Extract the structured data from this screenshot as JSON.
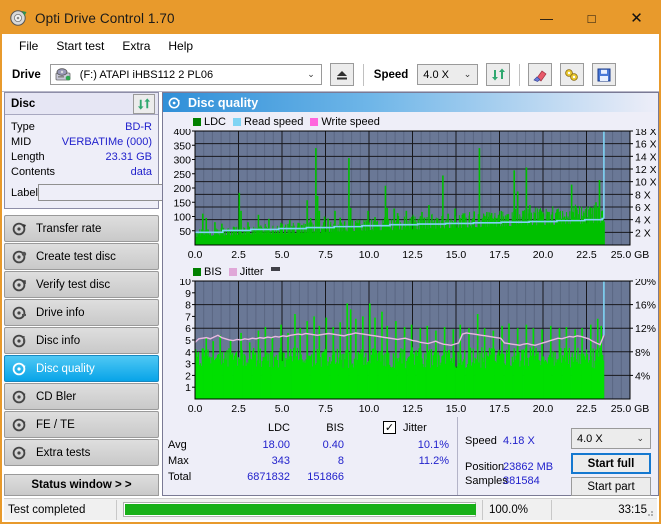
{
  "window": {
    "title": "Opti Drive Control 1.70",
    "icon": "disc-icon",
    "minimize": "—",
    "maximize": "□",
    "close": "✕",
    "titlebar_color": "#e89a2c"
  },
  "menu": {
    "items": [
      "File",
      "Start test",
      "Extra",
      "Help"
    ]
  },
  "toolbar": {
    "drive_label": "Drive",
    "drive_value": "(F:)  ATAPI iHBS112  2 PL06",
    "eject_icon": "eject-icon",
    "speed_label": "Speed",
    "speed_value": "4.0 X",
    "refresh_icon": "refresh-icon",
    "eraser_icon": "eraser-icon",
    "tools_icon": "tools-icon",
    "save_icon": "save-icon",
    "arrow": "⌄"
  },
  "disc_panel": {
    "title": "Disc",
    "refresh_icon": "refresh-icon",
    "rows": [
      {
        "key": "Type",
        "value": "BD-R"
      },
      {
        "key": "MID",
        "value": "VERBATIMe (000)"
      },
      {
        "key": "Length",
        "value": "23.31 GB"
      },
      {
        "key": "Contents",
        "value": "data"
      }
    ],
    "label_key": "Label",
    "label_value": "",
    "label_placeholder": "",
    "label_button_icon": "disc-icon"
  },
  "sidebar": {
    "items": [
      {
        "label": "Transfer rate",
        "icon": "disc-rate-icon",
        "selected": false
      },
      {
        "label": "Create test disc",
        "icon": "disc-create-icon",
        "selected": false
      },
      {
        "label": "Verify test disc",
        "icon": "disc-verify-icon",
        "selected": false
      },
      {
        "label": "Drive info",
        "icon": "drive-info-icon",
        "selected": false
      },
      {
        "label": "Disc info",
        "icon": "disc-info-icon",
        "selected": false
      },
      {
        "label": "Disc quality",
        "icon": "disc-quality-icon",
        "selected": true
      },
      {
        "label": "CD Bler",
        "icon": "cd-bler-icon",
        "selected": false
      },
      {
        "label": "FE / TE",
        "icon": "fe-te-icon",
        "selected": false
      },
      {
        "label": "Extra tests",
        "icon": "extra-tests-icon",
        "selected": false
      }
    ],
    "status_window_button": "Status window > >"
  },
  "panel": {
    "title": "Disc quality",
    "icon": "disc-quality-icon"
  },
  "results": {
    "col_ldc": "LDC",
    "col_bis": "BIS",
    "jitter_label": "Jitter",
    "jitter_checked": true,
    "check_glyph": "✓",
    "rows": [
      {
        "label": "Avg",
        "ldc": "18.00",
        "bis": "0.40",
        "jitter": "10.1%"
      },
      {
        "label": "Max",
        "ldc": "343",
        "bis": "8",
        "jitter": "11.2%"
      },
      {
        "label": "Total",
        "ldc": "6871832",
        "bis": "151866",
        "jitter": ""
      }
    ],
    "speed_label": "Speed",
    "speed_value": "4.18 X",
    "position_label": "Position",
    "position_value": "23862 MB",
    "samples_label": "Samples",
    "samples_value": "381584",
    "speed_select": "4.0 X",
    "speed_select_arrow": "⌄",
    "start_full": "Start full",
    "start_part": "Start part"
  },
  "statusbar": {
    "message": "Test completed",
    "progress_pct": "100.0%",
    "progress_value": 100,
    "elapsed": "33:15"
  },
  "colors": {
    "ldc_green": "#00c000",
    "read_speed_blue": "#7fd4f4",
    "write_speed_pink": "#ff66dd",
    "bis_green": "#00e000",
    "jitter_pink": "#e8b8e0",
    "plot_bg": "#6a7896",
    "accent": "#1478d0",
    "value_text": "#2222cc"
  },
  "chart_data": [
    {
      "type": "area",
      "name": "ldc-chart",
      "title": "",
      "xlabel": "GB",
      "ylabel": "",
      "legend": [
        {
          "label": "LDC",
          "color": "#008000"
        },
        {
          "label": "Read speed",
          "color": "#7fd4f4"
        },
        {
          "label": "Write speed",
          "color": "#ff66dd"
        }
      ],
      "legend_position": "top-left",
      "grid": true,
      "xlim": [
        0,
        25.0
      ],
      "ylim": [
        0,
        400
      ],
      "xticks": [
        0.0,
        2.5,
        5.0,
        7.5,
        10.0,
        12.5,
        15.0,
        17.5,
        20.0,
        22.5,
        25.0
      ],
      "xticklabels": [
        "0.0",
        "2.5",
        "5.0",
        "7.5",
        "10.0",
        "12.5",
        "15.0",
        "17.5",
        "20.0",
        "22.5",
        "25.0 GB"
      ],
      "yticks": [
        50,
        100,
        150,
        200,
        250,
        300,
        350,
        400
      ],
      "yticklabels": [
        "50",
        "100",
        "150",
        "200",
        "250",
        "300",
        "350",
        "400"
      ],
      "y2lim": [
        0,
        18
      ],
      "y2ticks": [
        2,
        4,
        6,
        8,
        10,
        12,
        14,
        16,
        18
      ],
      "y2ticklabels": [
        "2 X",
        "4 X",
        "6 X",
        "8 X",
        "10 X",
        "12 X",
        "14 X",
        "16 X",
        "18 X"
      ],
      "data_end_x": 23.5,
      "series": [
        {
          "name": "LDC",
          "color": "#00c000",
          "axis": "left",
          "baseline": [
            28,
            30,
            31,
            33,
            32,
            34,
            33,
            35,
            34,
            36,
            35,
            36,
            37,
            36,
            38,
            37,
            39,
            38,
            40,
            39,
            41,
            40,
            42,
            41,
            43,
            42,
            44,
            43,
            45,
            44,
            46,
            45,
            46,
            47,
            46,
            48,
            47,
            49,
            48,
            50,
            49,
            51,
            50,
            52,
            51,
            53,
            52,
            54,
            53,
            55,
            54,
            56,
            55,
            57,
            56,
            58,
            57,
            59,
            58,
            60,
            59,
            61,
            60,
            62,
            61,
            63,
            62,
            64,
            63,
            65,
            64,
            66,
            65,
            67,
            66,
            68,
            67,
            69,
            68,
            70,
            69,
            71,
            70,
            72,
            71,
            73,
            72,
            74,
            73,
            75,
            74,
            76,
            75,
            77,
            76,
            78
          ],
          "spikes": [
            [
              0.4,
              110
            ],
            [
              0.6,
              95
            ],
            [
              1.1,
              80
            ],
            [
              1.5,
              75
            ],
            [
              2.5,
              183
            ],
            [
              2.6,
              120
            ],
            [
              3.0,
              80
            ],
            [
              3.6,
              106
            ],
            [
              4.2,
              92
            ],
            [
              4.9,
              78
            ],
            [
              5.4,
              88
            ],
            [
              5.9,
              74
            ],
            [
              6.4,
              157
            ],
            [
              6.6,
              95
            ],
            [
              6.9,
              340
            ],
            [
              7.0,
              172
            ],
            [
              7.1,
              120
            ],
            [
              7.4,
              100
            ],
            [
              7.6,
              93
            ],
            [
              8.0,
              120
            ],
            [
              8.3,
              96
            ],
            [
              8.8,
              305
            ],
            [
              8.9,
              130
            ],
            [
              9.4,
              88
            ],
            [
              9.9,
              120
            ],
            [
              10.3,
              98
            ],
            [
              10.9,
              208
            ],
            [
              11.0,
              130
            ],
            [
              11.4,
              128
            ],
            [
              11.6,
              112
            ],
            [
              12.1,
              120
            ],
            [
              12.5,
              100
            ],
            [
              13.0,
              116
            ],
            [
              13.4,
              140
            ],
            [
              13.9,
              92
            ],
            [
              14.2,
              244
            ],
            [
              14.5,
              110
            ],
            [
              14.9,
              128
            ],
            [
              15.4,
              100
            ],
            [
              16.0,
              118
            ],
            [
              16.3,
              340
            ],
            [
              16.6,
              100
            ],
            [
              17.0,
              112
            ],
            [
              17.4,
              104
            ],
            [
              17.9,
              108
            ],
            [
              18.3,
              262
            ],
            [
              18.5,
              188
            ],
            [
              18.8,
              120
            ],
            [
              19.0,
              272
            ],
            [
              19.2,
              140
            ],
            [
              19.5,
              112
            ],
            [
              19.9,
              108
            ],
            [
              20.3,
              116
            ],
            [
              20.8,
              126
            ],
            [
              21.2,
              100
            ],
            [
              21.6,
              212
            ],
            [
              21.9,
              124
            ],
            [
              22.3,
              112
            ],
            [
              22.7,
              132
            ],
            [
              23.0,
              150
            ],
            [
              23.2,
              228
            ],
            [
              23.35,
              120
            ]
          ]
        },
        {
          "name": "Read speed",
          "color": "#7fd4f4",
          "axis": "right",
          "step_values": [
            [
              0.0,
              2.0
            ],
            [
              1.6,
              2.3
            ],
            [
              3.2,
              2.45
            ],
            [
              4.8,
              2.6
            ],
            [
              6.4,
              2.75
            ],
            [
              8.0,
              2.9
            ],
            [
              9.6,
              3.05
            ],
            [
              11.2,
              3.2
            ],
            [
              12.8,
              3.3
            ],
            [
              14.4,
              3.4
            ],
            [
              16.0,
              3.5
            ],
            [
              17.6,
              3.6
            ],
            [
              19.2,
              3.7
            ],
            [
              20.8,
              3.85
            ],
            [
              22.4,
              4.0
            ],
            [
              23.4,
              4.18
            ]
          ],
          "end_marker_x": 23.5,
          "end_marker_top": 18
        },
        {
          "name": "Write speed",
          "color": "#ff66dd",
          "axis": "right",
          "step_values": []
        }
      ]
    },
    {
      "type": "area",
      "name": "bis-jitter-chart",
      "title": "",
      "xlabel": "GB",
      "ylabel": "",
      "legend": [
        {
          "label": "BIS",
          "color": "#008000"
        },
        {
          "label": "Jitter",
          "color": "#e0a8d8"
        }
      ],
      "legend_position": "top-left",
      "grid": true,
      "xlim": [
        0,
        25.0
      ],
      "ylim": [
        0,
        10
      ],
      "xticks": [
        0.0,
        2.5,
        5.0,
        7.5,
        10.0,
        12.5,
        15.0,
        17.5,
        20.0,
        22.5,
        25.0
      ],
      "xticklabels": [
        "0.0",
        "2.5",
        "5.0",
        "7.5",
        "10.0",
        "12.5",
        "15.0",
        "17.5",
        "20.0",
        "22.5",
        "25.0 GB"
      ],
      "yticks": [
        1,
        2,
        3,
        4,
        5,
        6,
        7,
        8,
        9,
        10
      ],
      "yticklabels": [
        "1",
        "2",
        "3",
        "4",
        "5",
        "6",
        "7",
        "8",
        "9",
        "10"
      ],
      "y2lim": [
        0,
        20
      ],
      "y2ticks": [
        4,
        8,
        12,
        16,
        20
      ],
      "y2ticklabels": [
        "4%",
        "8%",
        "12%",
        "16%",
        "20%"
      ],
      "data_end_x": 23.5,
      "series": [
        {
          "name": "BIS",
          "color": "#00e000",
          "axis": "left",
          "band_low": 2.6,
          "band_high": 4.4,
          "spikes": [
            [
              0.6,
              5.2
            ],
            [
              1.0,
              4.9
            ],
            [
              1.4,
              5.4
            ],
            [
              2.0,
              5.0
            ],
            [
              2.6,
              5.6
            ],
            [
              3.1,
              4.8
            ],
            [
              3.6,
              5.8
            ],
            [
              4.0,
              6.1
            ],
            [
              4.4,
              5.3
            ],
            [
              4.9,
              6.3
            ],
            [
              5.3,
              5.6
            ],
            [
              5.7,
              7.2
            ],
            [
              6.0,
              6.0
            ],
            [
              6.4,
              6.6
            ],
            [
              6.8,
              7.0
            ],
            [
              7.1,
              6.2
            ],
            [
              7.5,
              6.9
            ],
            [
              7.9,
              6.1
            ],
            [
              8.3,
              6.5
            ],
            [
              8.7,
              8.1
            ],
            [
              8.9,
              7.6
            ],
            [
              9.2,
              6.8
            ],
            [
              9.6,
              7.0
            ],
            [
              10.0,
              8.1
            ],
            [
              10.3,
              6.9
            ],
            [
              10.7,
              7.4
            ],
            [
              11.0,
              6.2
            ],
            [
              11.5,
              6.6
            ],
            [
              12.0,
              6.1
            ],
            [
              12.4,
              6.3
            ],
            [
              12.9,
              6.0
            ],
            [
              13.3,
              6.2
            ],
            [
              13.8,
              5.8
            ],
            [
              14.3,
              6.1
            ],
            [
              14.8,
              5.9
            ],
            [
              15.2,
              6.3
            ],
            [
              15.7,
              6.0
            ],
            [
              16.2,
              7.2
            ],
            [
              16.6,
              6.0
            ],
            [
              17.1,
              5.8
            ],
            [
              17.6,
              6.2
            ],
            [
              18.0,
              6.4
            ],
            [
              18.5,
              6.0
            ],
            [
              19.0,
              6.3
            ],
            [
              19.4,
              6.0
            ],
            [
              19.9,
              5.9
            ],
            [
              20.4,
              6.2
            ],
            [
              20.9,
              6.0
            ],
            [
              21.3,
              6.1
            ],
            [
              21.8,
              5.9
            ],
            [
              22.2,
              6.0
            ],
            [
              22.7,
              6.3
            ],
            [
              23.1,
              6.8
            ],
            [
              23.3,
              6.2
            ]
          ]
        },
        {
          "name": "Jitter",
          "color": "#e8b8e0",
          "axis": "right",
          "values": [
            9.6,
            10.2,
            10.3,
            10.4,
            10.2,
            10.5,
            10.8,
            10.4,
            10.2,
            10.0,
            9.9,
            10.1,
            10.0,
            10.2,
            10.1,
            10.3,
            10.2,
            10.4,
            10.3,
            10.5,
            10.4,
            10.6,
            10.5,
            10.7,
            10.6,
            10.8,
            10.9,
            11.0,
            10.9,
            11.1,
            11.0,
            10.9,
            10.8,
            10.9,
            11.0,
            11.1,
            11.0,
            10.9,
            10.8,
            10.7,
            10.9,
            11.0,
            11.2,
            11.1,
            11.0,
            10.9,
            10.8,
            10.7,
            10.6,
            10.5,
            10.4,
            10.3,
            10.2,
            10.1,
            10.2,
            10.3,
            10.1,
            9.9,
            9.8,
            9.6,
            9.5,
            9.4,
            9.6,
            9.8,
            9.5,
            9.3,
            9.2,
            9.1,
            9.3,
            9.5,
            11.0,
            11.2,
            11.1,
            11.0,
            10.9,
            10.8,
            10.7,
            10.6,
            10.5,
            10.4,
            10.3,
            9.5,
            9.4,
            9.3,
            9.2,
            9.1,
            9.3,
            9.4,
            9.2,
            9.1,
            9.3,
            9.5,
            9.7,
            9.9,
            10.1,
            10.3,
            10.2,
            10.4,
            10.6,
            10.5,
            10.7,
            10.6,
            10.4,
            10.2,
            9.8,
            9.5,
            9.2,
            10.8
          ]
        }
      ]
    }
  ]
}
